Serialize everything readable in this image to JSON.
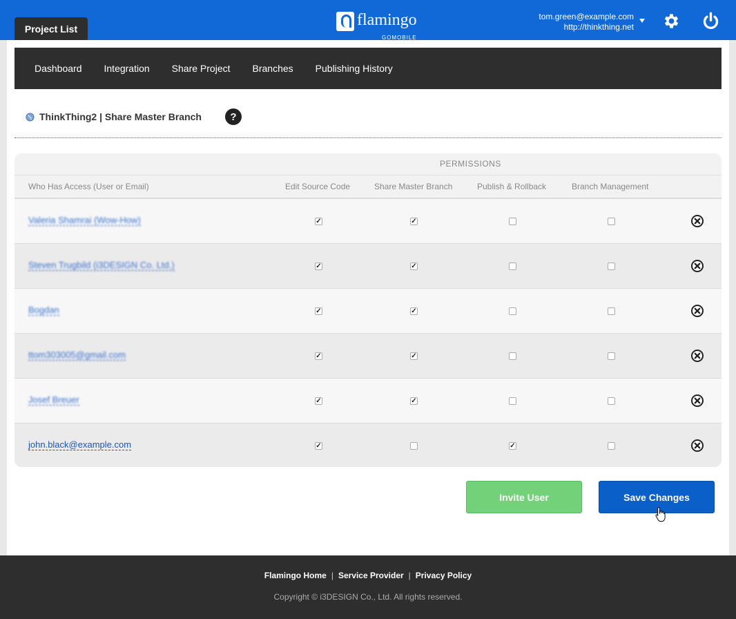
{
  "header": {
    "project_tab": "Project List",
    "logo_text": "flamingo",
    "logo_sub": "GOMOBILE",
    "user_email": "tom.green@example.com",
    "user_site": "http://thinkthing.net",
    "brand_color": "#1069d6"
  },
  "subnav": {
    "items": [
      "Dashboard",
      "Integration",
      "Share Project",
      "Branches",
      "Publishing History"
    ]
  },
  "breadcrumb": {
    "text": "ThinkThing2 | Share Master Branch",
    "help": "?"
  },
  "permissions_table": {
    "group_title": "PERMISSIONS",
    "columns": [
      "Who Has Access (User or Email)",
      "Edit Source Code",
      "Share Master Branch",
      "Publish & Rollback",
      "Branch Management"
    ],
    "rows": [
      {
        "name": "Valeria Shamrai (Wow-How)",
        "blurred": true,
        "perms": [
          true,
          true,
          false,
          false
        ]
      },
      {
        "name": "Steven Trugbild (i3DESIGN Co. Ltd.)",
        "blurred": true,
        "perms": [
          true,
          true,
          false,
          false
        ]
      },
      {
        "name": "Bogdan",
        "blurred": true,
        "perms": [
          true,
          true,
          false,
          false
        ]
      },
      {
        "name": "ttom303005@gmail.com",
        "blurred": true,
        "perms": [
          true,
          true,
          false,
          false
        ]
      },
      {
        "name": "Josef Breuer",
        "blurred": true,
        "perms": [
          true,
          true,
          false,
          false
        ]
      },
      {
        "name": "john.black@example.com",
        "blurred": false,
        "perms": [
          true,
          false,
          true,
          false
        ]
      }
    ]
  },
  "buttons": {
    "invite": "Invite User",
    "save": "Save Changes"
  },
  "footer": {
    "links": [
      "Flamingo Home",
      "Service Provider",
      "Privacy Policy"
    ],
    "separator": "|",
    "copyright": "Copyright © i3DESIGN Co., Ltd. All rights reserved."
  }
}
